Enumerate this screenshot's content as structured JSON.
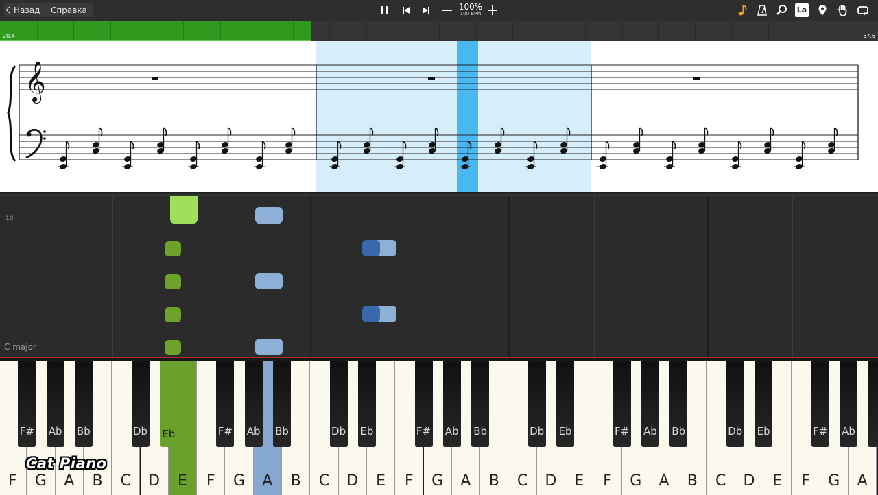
{
  "toolbar": {
    "back_label": "Назад",
    "help_label": "Справка",
    "tempo_percent": "100%",
    "tempo_bpm": "100 BPM",
    "lyrics_label": "La",
    "accent_color": "#f0a020"
  },
  "progress": {
    "start_time": "20.4",
    "end_time": "57.6",
    "fraction": 0.355,
    "fill_color": "#2f9a1e"
  },
  "roll": {
    "row_label": "10",
    "key_signature": "C major"
  },
  "keyboard": {
    "white_keys": [
      "F",
      "G",
      "A",
      "B",
      "C",
      "D",
      "E",
      "F",
      "G",
      "A",
      "B",
      "C",
      "D",
      "E",
      "F",
      "G",
      "A",
      "B",
      "C",
      "D",
      "E",
      "F",
      "G",
      "A",
      "B",
      "C",
      "D",
      "E",
      "F",
      "G",
      "A"
    ],
    "black_keys": [
      "F#",
      "Ab",
      "Bb",
      "Db",
      "Eb",
      "F#",
      "Ab",
      "Bb",
      "Db",
      "Eb",
      "F#",
      "Ab",
      "Bb",
      "Db",
      "Eb",
      "F#",
      "Ab",
      "Bb",
      "Db",
      "Eb",
      "F#",
      "Ab",
      ""
    ],
    "active_green_white": 6,
    "active_blue_white": 9,
    "active_green_black": 4,
    "green_color": "#6aa12c",
    "blue_color": "#86a8d0"
  },
  "watermark": "Cat Piano"
}
